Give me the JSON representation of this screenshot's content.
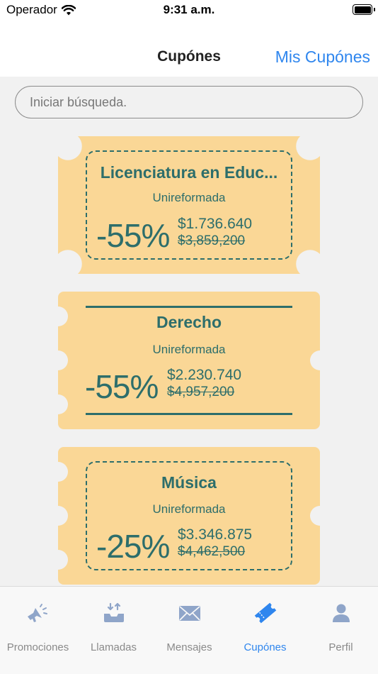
{
  "status_bar": {
    "carrier": "Operador",
    "time": "9:31 a.m."
  },
  "nav": {
    "title": "Cupónes",
    "action": "Mis Cupónes"
  },
  "search": {
    "placeholder": "Iniciar búsqueda."
  },
  "coupons": [
    {
      "title": "Licenciatura en Educ...",
      "provider": "Unireformada",
      "discount": "-55%",
      "price": "$1.736.640",
      "old_price": "$3,859,200",
      "style": "dashed"
    },
    {
      "title": "Derecho",
      "provider": "Unireformada",
      "discount": "-55%",
      "price": "$2.230.740",
      "old_price": "$4,957,200",
      "style": "lines"
    },
    {
      "title": "Música",
      "provider": "Unireformada",
      "discount": "-25%",
      "price": "$3.346.875",
      "old_price": "$4,462,500",
      "style": "dashed"
    }
  ],
  "tabs": [
    {
      "label": "Promociones",
      "icon": "megaphone-icon",
      "active": false
    },
    {
      "label": "Llamadas",
      "icon": "inbox-download-icon",
      "active": false
    },
    {
      "label": "Mensajes",
      "icon": "envelope-icon",
      "active": false
    },
    {
      "label": "Cupónes",
      "icon": "ticket-icon",
      "active": true
    },
    {
      "label": "Perfil",
      "icon": "user-icon",
      "active": false
    }
  ],
  "colors": {
    "accent": "#2f86ee",
    "coupon_bg": "#fad796",
    "coupon_text": "#2d6e6b",
    "inactive_icon": "#8fa5c9"
  }
}
